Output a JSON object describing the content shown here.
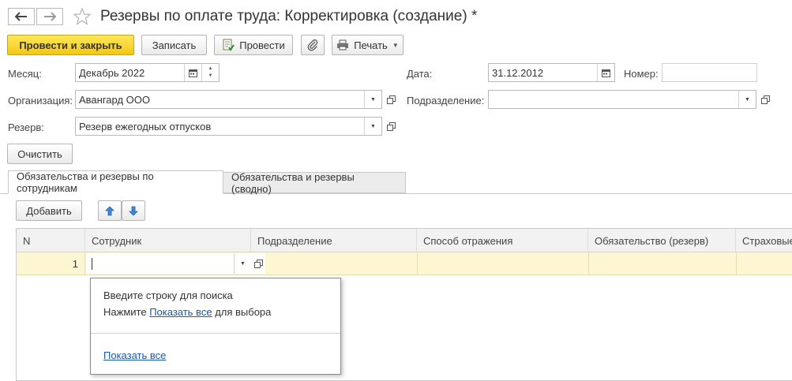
{
  "window": {
    "title": "Резервы по оплате труда: Корректировка (создание) *"
  },
  "toolbar": {
    "post_close": "Провести и закрыть",
    "save": "Записать",
    "post": "Провести",
    "print": "Печать"
  },
  "form": {
    "month_label": "Месяц:",
    "month_value": "Декабрь 2022",
    "date_label": "Дата:",
    "date_value": "31.12.2012",
    "number_label": "Номер:",
    "number_value": "",
    "org_label": "Организация:",
    "org_value": "Авангард ООО",
    "dept_label": "Подразделение:",
    "dept_value": "",
    "reserve_label": "Резерв:",
    "reserve_value": "Резерв ежегодных отпусков",
    "clear_button": "Очистить"
  },
  "tabs": [
    {
      "label": "Обязательства и резервы по сотрудникам",
      "active": true
    },
    {
      "label": "Обязательства и резервы (сводно)",
      "active": false
    }
  ],
  "table_toolbar": {
    "add": "Добавить"
  },
  "table": {
    "columns": [
      "N",
      "Сотрудник",
      "Подразделение",
      "Способ отражения",
      "Обязательство (резерв)",
      "Страховые"
    ],
    "rows": [
      {
        "n": "1",
        "employee": ""
      }
    ]
  },
  "dropdown": {
    "line1": "Введите строку для поиска",
    "line2_prefix": "Нажмите",
    "line2_link": "Показать все",
    "line2_suffix": "для выбора",
    "footer_link": "Показать все"
  },
  "colors": {
    "primary": "#f5cc1d",
    "row_highlight": "#fdf6d3",
    "link": "#1a56a6"
  }
}
